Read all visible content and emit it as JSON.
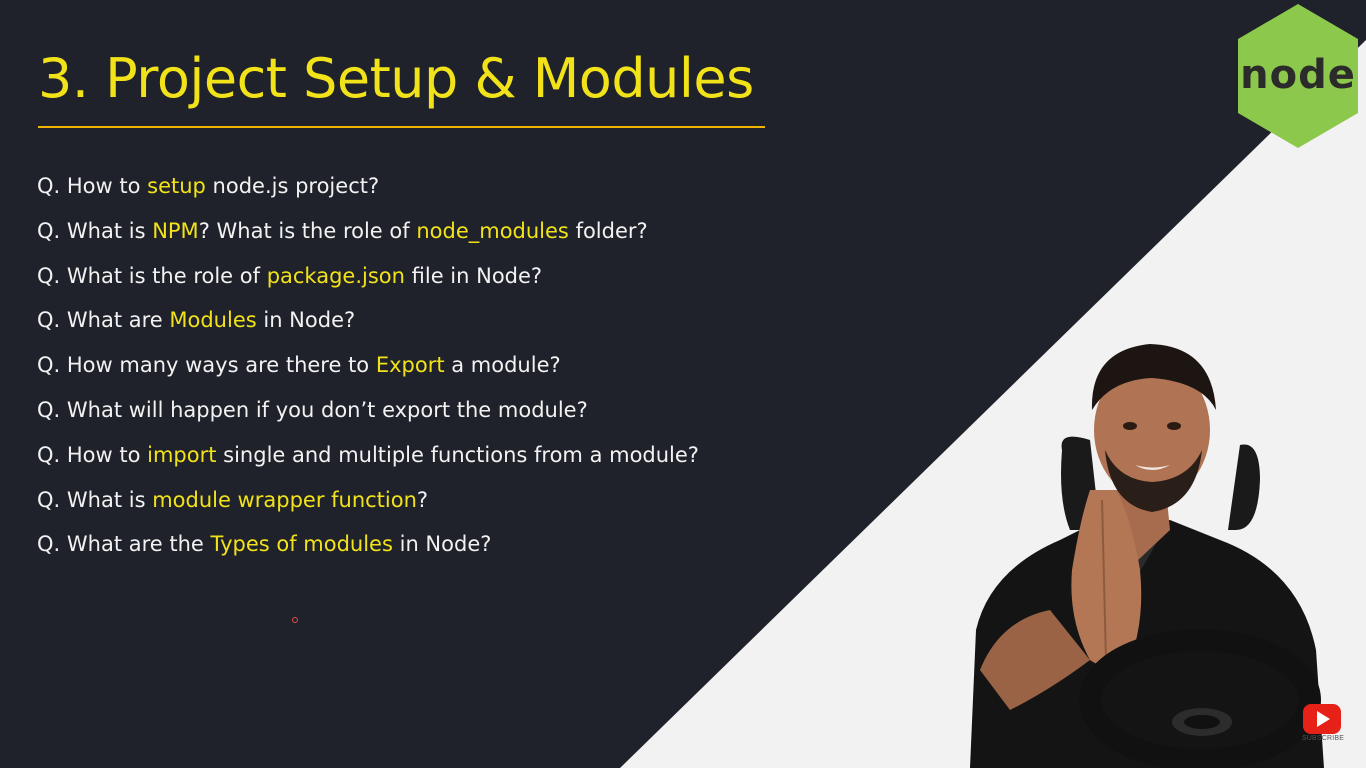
{
  "slide": {
    "title": "3. Project Setup & Modules",
    "questions": [
      {
        "pre": "Q. How to ",
        "hl": "setup",
        "mid": " node.js project?",
        "hl2": "",
        "post": ""
      },
      {
        "pre": "Q. What is ",
        "hl": "NPM",
        "mid": "? What is the role of ",
        "hl2": "node_modules",
        "post": " folder?"
      },
      {
        "pre": "Q. What is the role of ",
        "hl": "package.json",
        "mid": " file in Node?",
        "hl2": "",
        "post": ""
      },
      {
        "pre": "Q. What are ",
        "hl": "Modules",
        "mid": " in Node?",
        "hl2": "",
        "post": ""
      },
      {
        "pre": "Q. How many ways are there to ",
        "hl": "Export",
        "mid": " a module?",
        "hl2": "",
        "post": ""
      },
      {
        "pre": "Q. What will happen if you don’t export the module?",
        "hl": "",
        "mid": "",
        "hl2": "",
        "post": ""
      },
      {
        "pre": "Q. How to ",
        "hl": "import",
        "mid": " single and multiple functions from a module?",
        "hl2": "",
        "post": ""
      },
      {
        "pre": "Q. What is ",
        "hl": "module wrapper function",
        "mid": "?",
        "hl2": "",
        "post": ""
      },
      {
        "pre": "Q. What are the ",
        "hl": "Types of modules",
        "mid": " in Node?",
        "hl2": "",
        "post": ""
      }
    ]
  },
  "logo": {
    "text": "node",
    "icon": "nodejs-hexagon-icon",
    "color": "#8cc84b"
  },
  "presenter": {
    "icon": "presenter-photo"
  },
  "subscribe": {
    "label": "SUBSCRIBE",
    "icon": "youtube-play-icon",
    "color": "#e62117"
  },
  "colors": {
    "background_dark": "#1f222a",
    "background_light": "#f2f2f2",
    "title": "#f2e21a",
    "highlight": "#f2e21a",
    "text": "#f2f2f2",
    "rule": "#f0b400"
  }
}
